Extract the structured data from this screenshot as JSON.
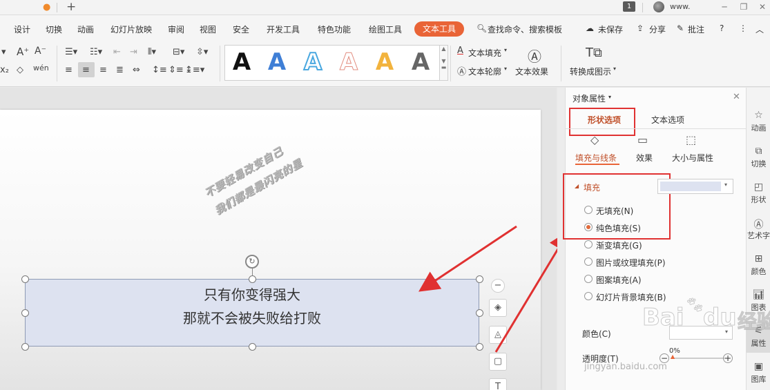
{
  "titlebar": {
    "page_badge": "1",
    "user_name": "www."
  },
  "menu": {
    "items": [
      "设计",
      "切换",
      "动画",
      "幻灯片放映",
      "审阅",
      "视图",
      "安全",
      "开发工具",
      "特色功能",
      "绘图工具"
    ],
    "active": "文本工具",
    "search": "查找命令、搜索模板",
    "unsaved": "未保存",
    "share": "分享",
    "annotate": "批注"
  },
  "ribbon": {
    "gallery_letter": "A",
    "text_fill": "文本填充",
    "text_outline": "文本轮廓",
    "text_effect": "文本效果",
    "convert_chart": "转换成图示"
  },
  "slide": {
    "wordart_line1": "不要轻易改变自己",
    "wordart_line2": "我们都是最闪亮的星",
    "textbox_line1": "只有你变得强大",
    "textbox_line2": "那就不会被失败给打败"
  },
  "panel": {
    "title": "对象属性",
    "tab_shape": "形状选项",
    "tab_text": "文本选项",
    "sub_fill_line": "填充与线条",
    "sub_effect": "效果",
    "sub_size": "大小与属性",
    "section_fill": "填充",
    "options": [
      {
        "label": "无填充(N)",
        "checked": false
      },
      {
        "label": "纯色填充(S)",
        "checked": true
      },
      {
        "label": "渐变填充(G)",
        "checked": false
      },
      {
        "label": "图片或纹理填充(P)",
        "checked": false
      },
      {
        "label": "图案填充(A)",
        "checked": false
      },
      {
        "label": "幻灯片背景填充(B)",
        "checked": false
      }
    ],
    "color_label": "颜色(C)",
    "transparency_label": "透明度(T)",
    "transparency_value": "0%"
  },
  "sidebar": {
    "items": [
      "动画",
      "切换",
      "形状",
      "艺术字",
      "颜色",
      "图表",
      "属性",
      "图库"
    ]
  },
  "watermark": {
    "brand": "Bai",
    "brand2": "du",
    "brand3": "经验",
    "url": "jingyan.baidu.com"
  },
  "colors": {
    "accent": "#e96437",
    "highlight_red": "#e03131",
    "textbox_fill": "#dde2f0"
  }
}
